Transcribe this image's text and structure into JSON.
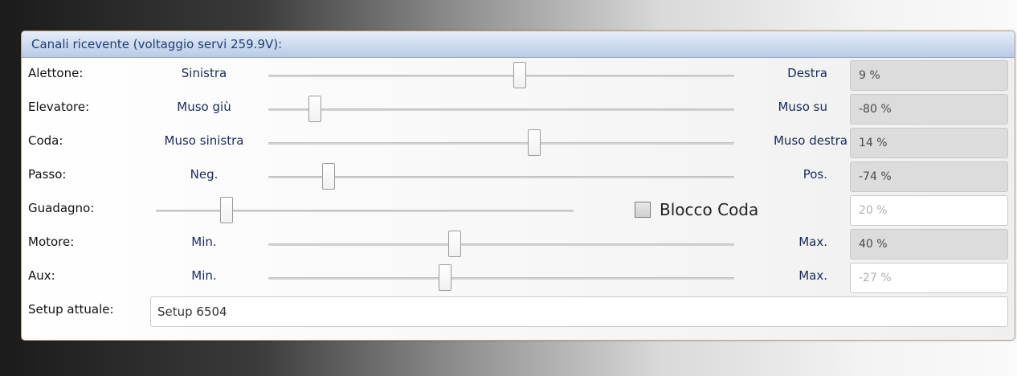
{
  "panel": {
    "title": "Canali ricevente (voltaggio servi 259.9V):"
  },
  "channels": [
    {
      "label": "Alettone:",
      "left": "Sinistra",
      "right": "Destra",
      "value": "9 %",
      "position_pct": 0.54
    },
    {
      "label": "Elevatore:",
      "left": "Muso giù",
      "right": "Muso su",
      "value": "-80 %",
      "position_pct": 0.1
    },
    {
      "label": "Coda:",
      "left": "Muso sinistra",
      "right": "Muso destra",
      "value": "14 %",
      "position_pct": 0.57
    },
    {
      "label": "Passo:",
      "left": "Neg.",
      "right": "Pos.",
      "value": "-74 %",
      "position_pct": 0.13
    },
    {
      "label": "Motore:",
      "left": "Min.",
      "right": "Max.",
      "value": "40 %",
      "position_pct": 0.4
    },
    {
      "label": "Aux:",
      "left": "Min.",
      "right": "Max.",
      "value": "-27 %",
      "position_pct": 0.38
    }
  ],
  "gain": {
    "label": "Guadagno:",
    "value": "20 %",
    "position_pct": 0.17,
    "checkbox_label": "Blocco Coda",
    "checkbox_checked": false
  },
  "setup": {
    "label": "Setup attuale:",
    "value": "Setup 6504"
  }
}
